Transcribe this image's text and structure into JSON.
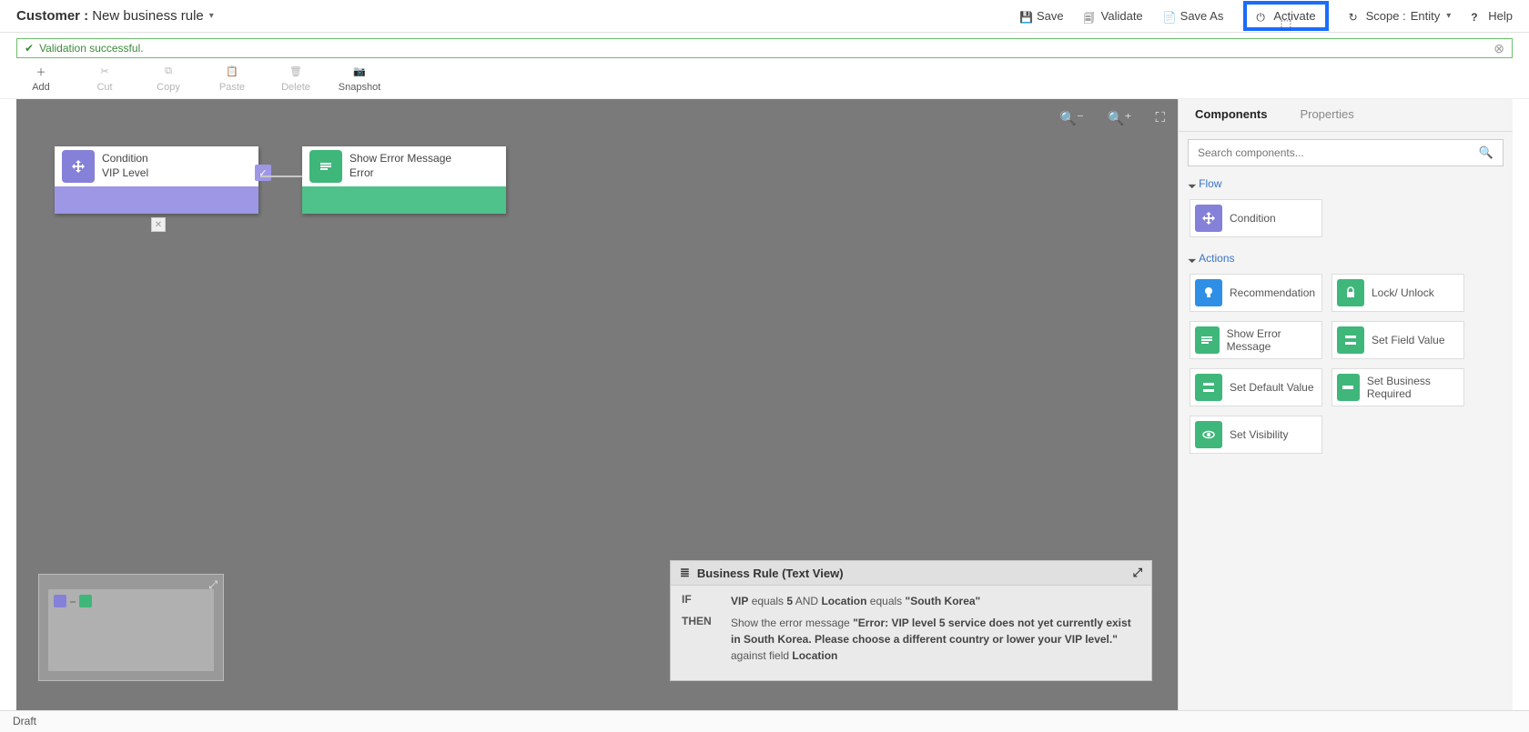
{
  "header": {
    "entity": "Customer :",
    "title": "New business rule",
    "buttons": {
      "save": "Save",
      "validate": "Validate",
      "saveAs": "Save As",
      "activate": "Activate",
      "scopeLabel": "Scope :",
      "scopeValue": "Entity",
      "help": "Help"
    }
  },
  "validation": {
    "message": "Validation successful."
  },
  "toolbar": {
    "add": "Add",
    "cut": "Cut",
    "copy": "Copy",
    "paste": "Paste",
    "delete": "Delete",
    "snapshot": "Snapshot"
  },
  "canvas": {
    "nodeCondition": {
      "title": "Condition",
      "subtitle": "VIP Level"
    },
    "nodeAction": {
      "title": "Show Error Message",
      "subtitle": "Error"
    }
  },
  "textView": {
    "title": "Business Rule (Text View)",
    "ifLabel": "IF",
    "thenLabel": "THEN",
    "ifField1": "VIP",
    "ifOp1": "equals",
    "ifVal1": "5",
    "ifAnd": "AND",
    "ifField2": "Location",
    "ifOp2": "equals",
    "ifVal2": "\"South Korea\"",
    "thenPre": "Show the error message",
    "thenMsg": "\"Error: VIP level 5 service does not yet currently exist in South Korea. Please choose a different country or lower your VIP level.\"",
    "thenAgainst": "against field",
    "thenField": "Location"
  },
  "sidebar": {
    "tabs": {
      "components": "Components",
      "properties": "Properties"
    },
    "searchPlaceholder": "Search components...",
    "secFlow": "Flow",
    "secActions": "Actions",
    "flow": {
      "condition": "Condition"
    },
    "actions": {
      "recommendation": "Recommendation",
      "lock": "Lock/ Unlock",
      "error": "Show Error Message",
      "setField": "Set Field Value",
      "setDefault": "Set Default Value",
      "setBiz": "Set Business Required",
      "setVis": "Set Visibility"
    }
  },
  "footer": {
    "status": "Draft"
  }
}
